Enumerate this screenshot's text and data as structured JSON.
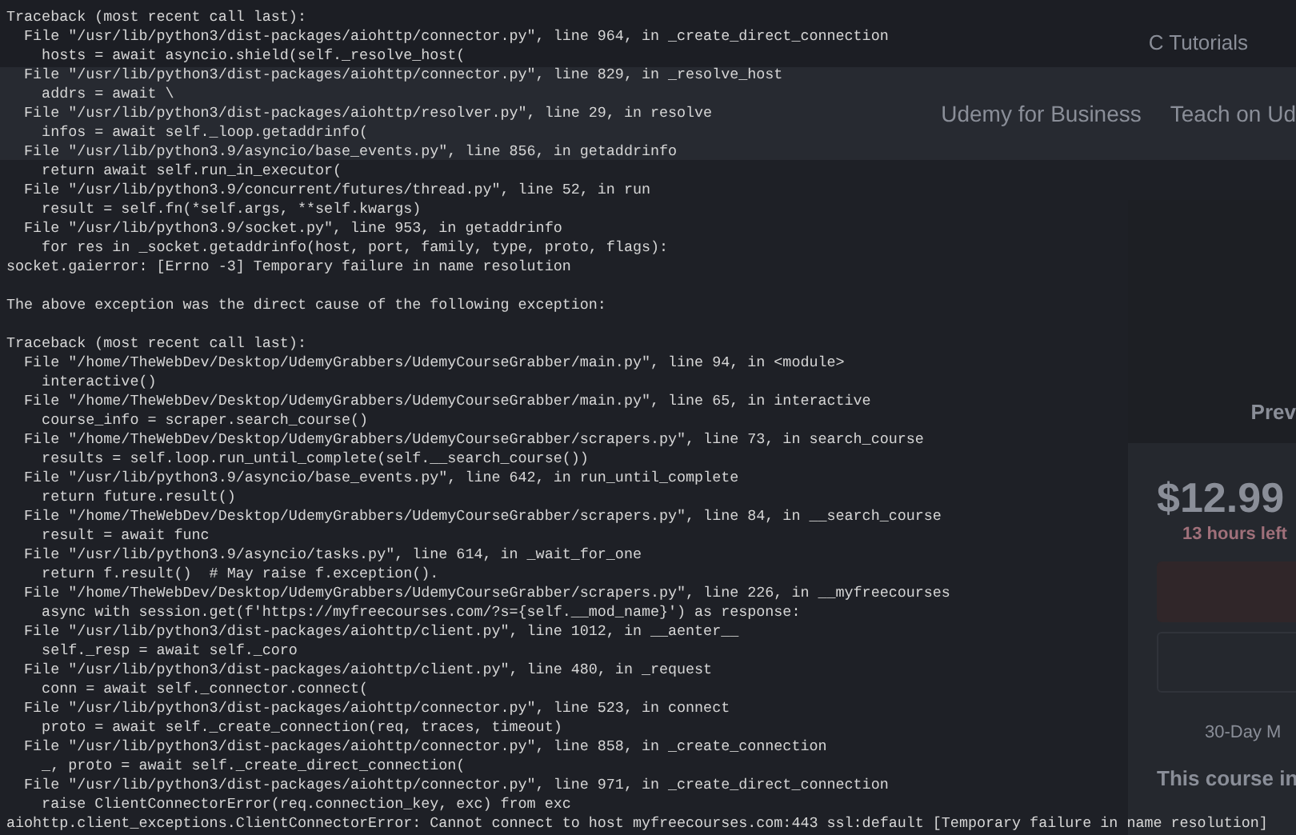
{
  "page": {
    "bookmark": "C Tutorials",
    "nav_links": [
      "Udemy for Business",
      "Teach on Ud"
    ],
    "preview_label": "Prev",
    "price": "$12.99",
    "time_left": "13 hours left",
    "guarantee": "30-Day M",
    "section_title": "This course in"
  },
  "terminal": {
    "blocks": [
      [
        "Traceback (most recent call last):",
        "  File \"/usr/lib/python3/dist-packages/aiohttp/connector.py\", line 964, in _create_direct_connection",
        "    hosts = await asyncio.shield(self._resolve_host(",
        "  File \"/usr/lib/python3/dist-packages/aiohttp/connector.py\", line 829, in _resolve_host",
        "    addrs = await \\",
        "  File \"/usr/lib/python3/dist-packages/aiohttp/resolver.py\", line 29, in resolve",
        "    infos = await self._loop.getaddrinfo(",
        "  File \"/usr/lib/python3.9/asyncio/base_events.py\", line 856, in getaddrinfo",
        "    return await self.run_in_executor(",
        "  File \"/usr/lib/python3.9/concurrent/futures/thread.py\", line 52, in run",
        "    result = self.fn(*self.args, **self.kwargs)",
        "  File \"/usr/lib/python3.9/socket.py\", line 953, in getaddrinfo",
        "    for res in _socket.getaddrinfo(host, port, family, type, proto, flags):",
        "socket.gaierror: [Errno -3] Temporary failure in name resolution"
      ],
      [
        "The above exception was the direct cause of the following exception:"
      ],
      [
        "Traceback (most recent call last):",
        "  File \"/home/TheWebDev/Desktop/UdemyGrabbers/UdemyCourseGrabber/main.py\", line 94, in <module>",
        "    interactive()",
        "  File \"/home/TheWebDev/Desktop/UdemyGrabbers/UdemyCourseGrabber/main.py\", line 65, in interactive",
        "    course_info = scraper.search_course()",
        "  File \"/home/TheWebDev/Desktop/UdemyGrabbers/UdemyCourseGrabber/scrapers.py\", line 73, in search_course",
        "    results = self.loop.run_until_complete(self.__search_course())",
        "  File \"/usr/lib/python3.9/asyncio/base_events.py\", line 642, in run_until_complete",
        "    return future.result()",
        "  File \"/home/TheWebDev/Desktop/UdemyGrabbers/UdemyCourseGrabber/scrapers.py\", line 84, in __search_course",
        "    result = await func",
        "  File \"/usr/lib/python3.9/asyncio/tasks.py\", line 614, in _wait_for_one",
        "    return f.result()  # May raise f.exception().",
        "  File \"/home/TheWebDev/Desktop/UdemyGrabbers/UdemyCourseGrabber/scrapers.py\", line 226, in __myfreecourses",
        "    async with session.get(f'https://myfreecourses.com/?s={self.__mod_name}') as response:",
        "  File \"/usr/lib/python3/dist-packages/aiohttp/client.py\", line 1012, in __aenter__",
        "    self._resp = await self._coro",
        "  File \"/usr/lib/python3/dist-packages/aiohttp/client.py\", line 480, in _request",
        "    conn = await self._connector.connect(",
        "  File \"/usr/lib/python3/dist-packages/aiohttp/connector.py\", line 523, in connect",
        "    proto = await self._create_connection(req, traces, timeout)",
        "  File \"/usr/lib/python3/dist-packages/aiohttp/connector.py\", line 858, in _create_connection",
        "    _, proto = await self._create_direct_connection(",
        "  File \"/usr/lib/python3/dist-packages/aiohttp/connector.py\", line 971, in _create_direct_connection",
        "    raise ClientConnectorError(req.connection_key, exc) from exc",
        "aiohttp.client_exceptions.ClientConnectorError: Cannot connect to host myfreecourses.com:443 ssl:default [Temporary failure in name resolution]"
      ]
    ]
  }
}
